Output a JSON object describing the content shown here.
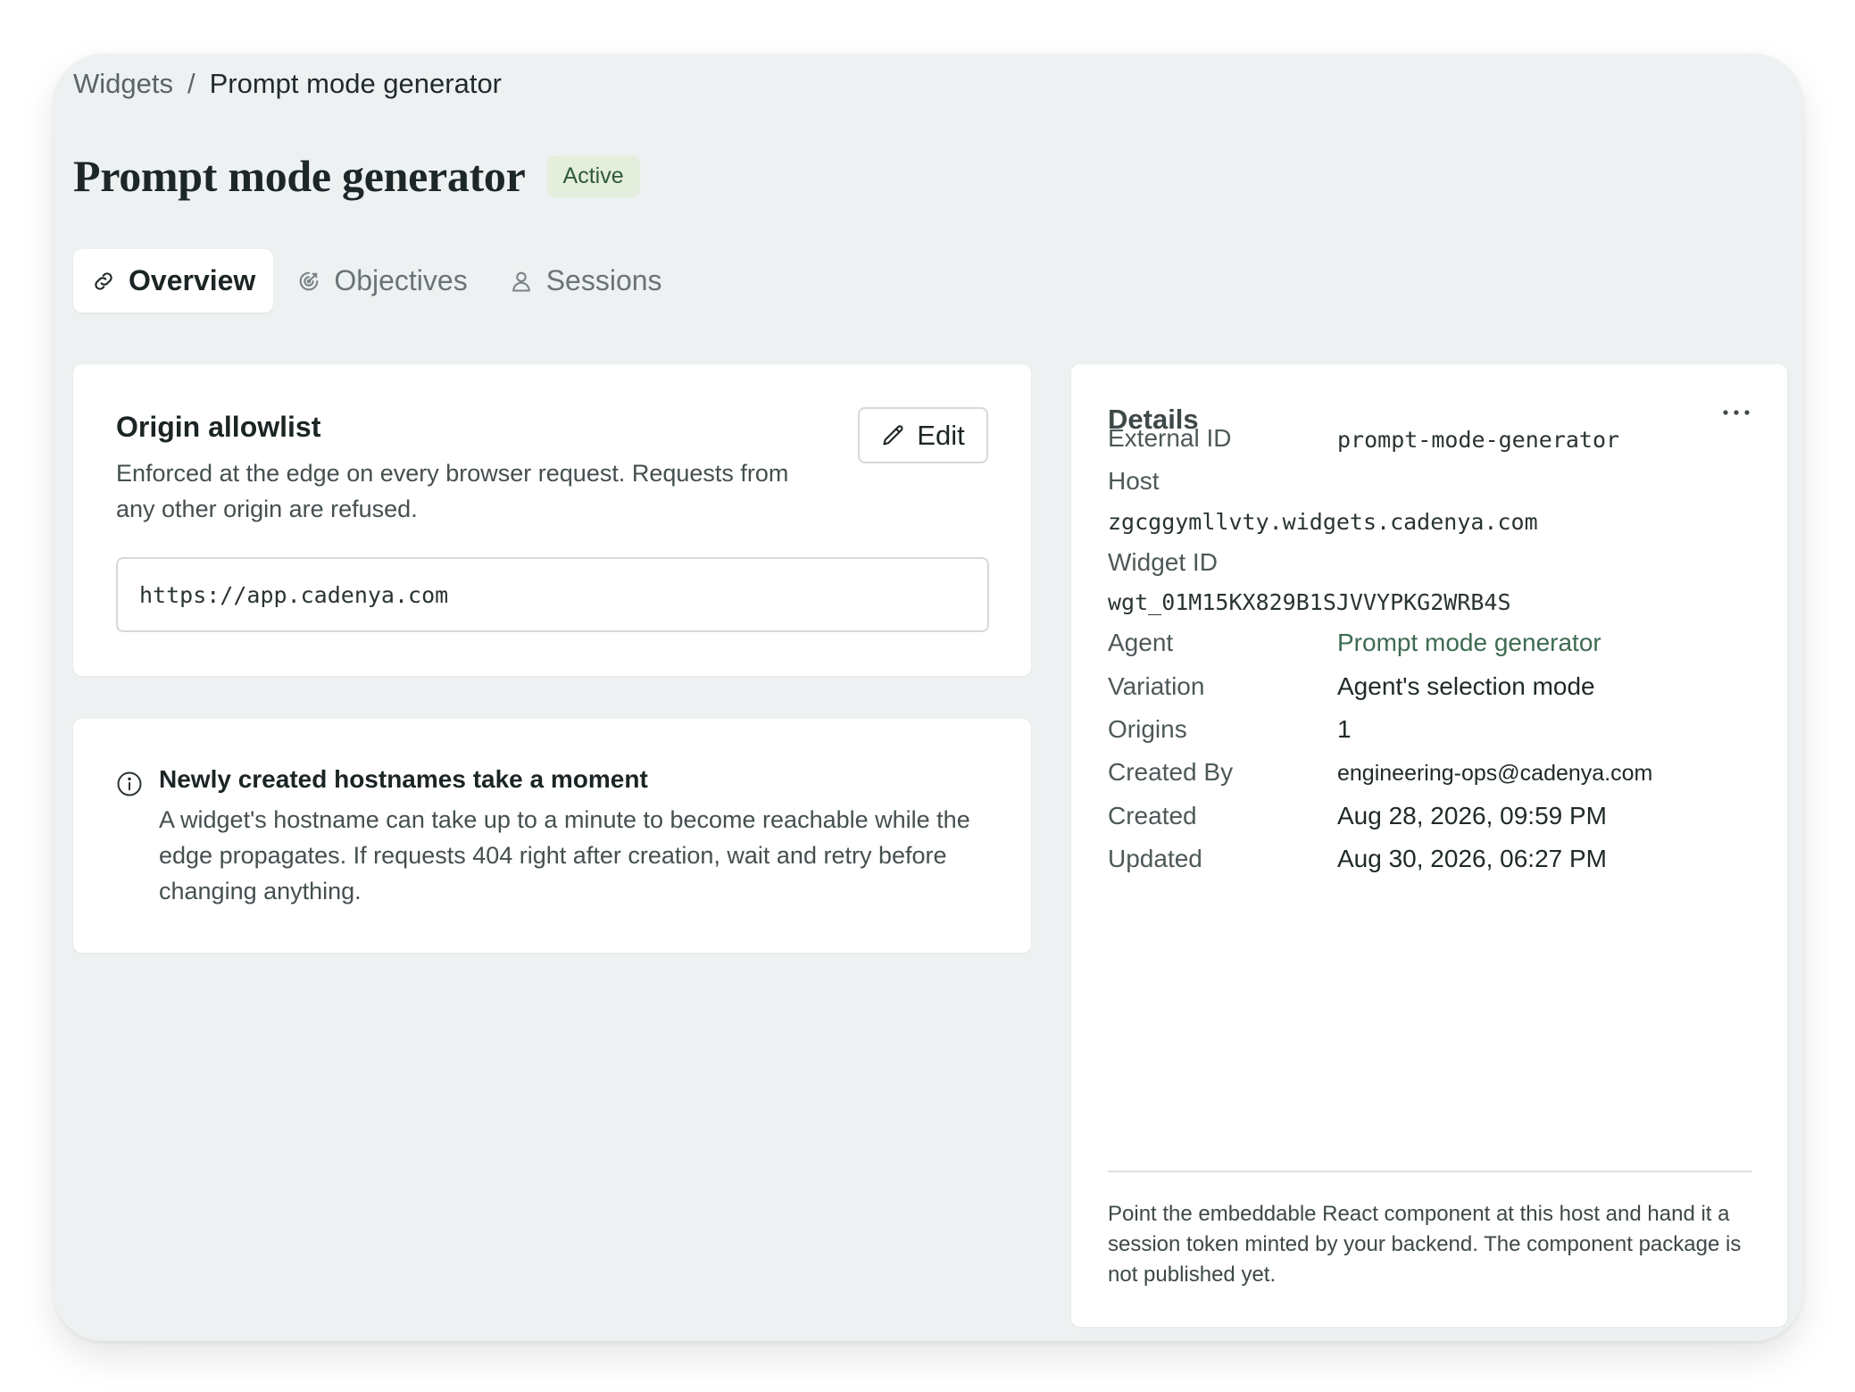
{
  "breadcrumb": {
    "parent": "Widgets",
    "separator": "/",
    "current": "Prompt mode generator"
  },
  "header": {
    "title": "Prompt mode generator",
    "status": "Active"
  },
  "tabs": [
    {
      "label": "Overview",
      "icon": "link-icon",
      "active": true
    },
    {
      "label": "Objectives",
      "icon": "target-icon",
      "active": false
    },
    {
      "label": "Sessions",
      "icon": "user-icon",
      "active": false
    }
  ],
  "origin_allowlist": {
    "title": "Origin allowlist",
    "description": "Enforced at the edge on every browser request. Requests from any other origin are refused.",
    "edit_label": "Edit",
    "origin_value": "https://app.cadenya.com"
  },
  "notice": {
    "title": "Newly created hostnames take a moment",
    "body": "A widget's hostname can take up to a minute to become reachable while the edge propagates. If requests 404 right after creation, wait and retry before changing anything."
  },
  "details": {
    "title": "Details",
    "external_id_label": "External ID",
    "external_id": "prompt-mode-generator",
    "host_label": "Host",
    "host": "zgcggymllvty.widgets.cadenya.com",
    "widget_id_label": "Widget ID",
    "widget_id": "wgt_01M15KX829B1SJVVYPKG2WRB4S",
    "agent_label": "Agent",
    "agent": "Prompt mode generator",
    "variation_label": "Variation",
    "variation": "Agent's selection mode",
    "origins_label": "Origins",
    "origins": "1",
    "created_by_label": "Created By",
    "created_by": "engineering-ops@cadenya.com",
    "created_label": "Created",
    "created": "Aug 28, 2026, 09:59 PM",
    "updated_label": "Updated",
    "updated": "Aug 30, 2026, 06:27 PM",
    "note": "Point the embeddable React component at this host and hand it a session token minted by your backend. The component package is not published yet."
  },
  "colors": {
    "accent_link": "#3d6b52",
    "badge_bg": "#e4eedc",
    "badge_text": "#2f5a3a",
    "page_bg": "#eef1f1"
  }
}
